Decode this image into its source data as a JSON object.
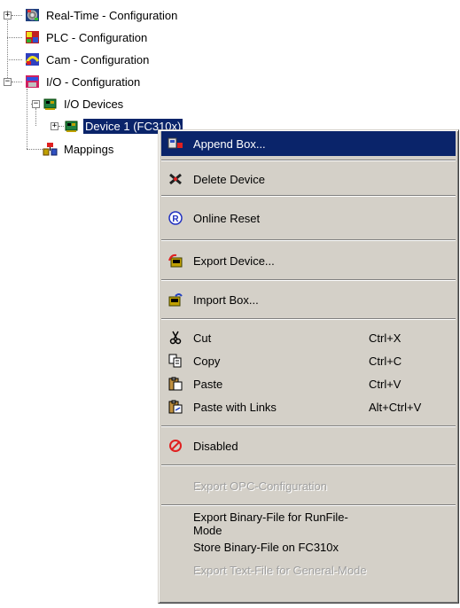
{
  "tree": {
    "items": [
      {
        "label": "Real-Time - Configuration",
        "icon": "realtime-config-icon"
      },
      {
        "label": "PLC - Configuration",
        "icon": "plc-config-icon"
      },
      {
        "label": "Cam - Configuration",
        "icon": "cam-config-icon"
      },
      {
        "label": "I/O - Configuration",
        "icon": "io-config-icon"
      },
      {
        "label": "I/O Devices",
        "icon": "io-devices-icon"
      },
      {
        "label": "Device 1 (FC310x)",
        "icon": "device-card-icon"
      },
      {
        "label": "Mappings",
        "icon": "mappings-icon"
      }
    ],
    "expander_plus": "+",
    "expander_minus": "−"
  },
  "menu": {
    "items": [
      {
        "label": "Append Box...",
        "icon": "append-box-icon",
        "shortcut": ""
      },
      {
        "label": "Delete Device",
        "icon": "delete-device-icon",
        "shortcut": ""
      },
      {
        "label": "Online Reset",
        "icon": "online-reset-icon",
        "shortcut": ""
      },
      {
        "label": "Export Device...",
        "icon": "export-device-icon",
        "shortcut": ""
      },
      {
        "label": "Import Box...",
        "icon": "import-box-icon",
        "shortcut": ""
      },
      {
        "label": "Cut",
        "icon": "scissors-icon",
        "shortcut": "Ctrl+X"
      },
      {
        "label": "Copy",
        "icon": "copy-icon",
        "shortcut": "Ctrl+C"
      },
      {
        "label": "Paste",
        "icon": "paste-icon",
        "shortcut": "Ctrl+V"
      },
      {
        "label": "Paste with Links",
        "icon": "paste-links-icon",
        "shortcut": "Alt+Ctrl+V"
      },
      {
        "label": "Disabled",
        "icon": "disabled-icon",
        "shortcut": ""
      },
      {
        "label": "Export OPC-Configuration",
        "shortcut": "",
        "disabled": true
      },
      {
        "label": "Export Binary-File for RunFile-Mode",
        "shortcut": ""
      },
      {
        "label": "Store Binary-File on FC310x",
        "shortcut": ""
      },
      {
        "label": "Export Text-File for General-Mode",
        "shortcut": "",
        "disabled": true
      }
    ],
    "highlight_color": "#0a246a",
    "background_color": "#d4d0c8"
  }
}
